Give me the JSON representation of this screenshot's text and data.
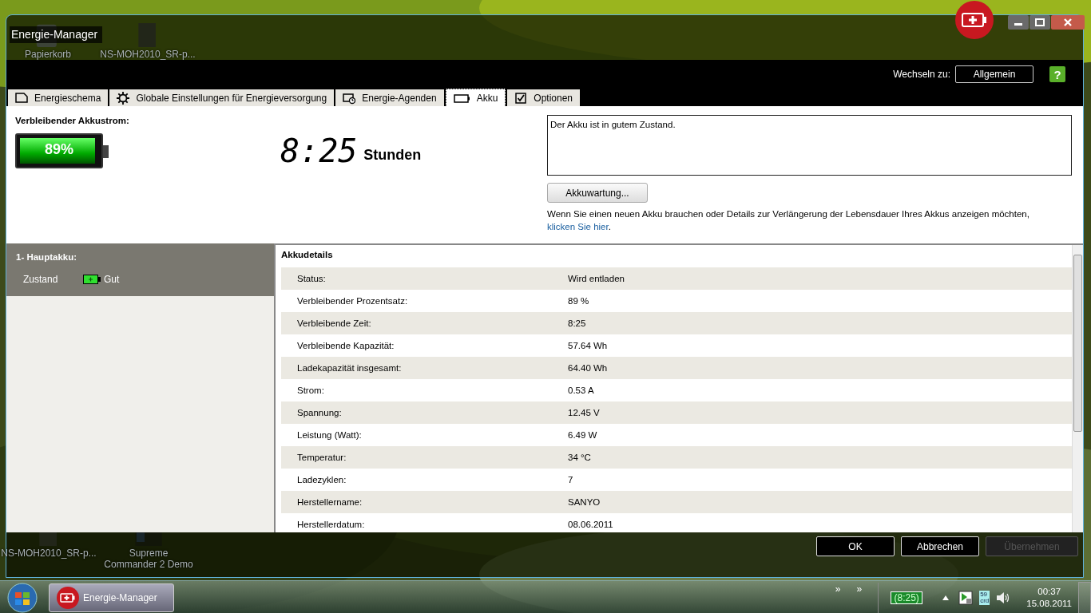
{
  "desktop": {
    "icons": [
      {
        "label": "Papierkorb",
        "kind": "bin"
      },
      {
        "label": "NS-MOH2010_SR-p...",
        "kind": "file"
      },
      {
        "label": "NS-MOH2010_SR-p...",
        "kind": "file"
      },
      {
        "label": "Supreme Commander 2 Demo",
        "kind": "game"
      }
    ]
  },
  "window": {
    "title": "Energie-Manager",
    "switch_label": "Wechseln zu:",
    "switch_button": "Allgemein",
    "help_glyph": "?",
    "tabs": [
      {
        "label": "Energieschema",
        "kind": "page",
        "selected": false
      },
      {
        "label": "Globale Einstellungen für Energieversorgung",
        "kind": "gear",
        "selected": false
      },
      {
        "label": "Energie-Agenden",
        "kind": "schedule",
        "selected": false
      },
      {
        "label": "Akku",
        "kind": "battery",
        "selected": true
      },
      {
        "label": "Optionen",
        "kind": "checkbox",
        "selected": false
      }
    ],
    "remaining": {
      "label": "Verbleibender Akkustrom:",
      "level": 0.89,
      "percent": "89%",
      "time": "8:25",
      "unit": "Stunden"
    },
    "status_message": "Der Akku ist in gutem Zustand.",
    "maintenance_button": "Akkuwartung...",
    "info_text": "Wenn Sie einen neuen Akku brauchen oder Details zur Verlängerung der Lebensdauer Ihres Akkus anzeigen möchten,",
    "info_link": "klicken Sie hier",
    "info_end": ".",
    "battery_list": {
      "title": "1- Hauptakku:",
      "state_label": "Zustand",
      "state_value": "Gut"
    },
    "details": {
      "title": "Akkudetails",
      "rows": [
        {
          "label": "Status:",
          "value": "Wird entladen"
        },
        {
          "label": "Verbleibender Prozentsatz:",
          "value": "89 %"
        },
        {
          "label": "Verbleibende Zeit:",
          "value": "8:25"
        },
        {
          "label": "Verbleibende Kapazität:",
          "value": "57.64 Wh"
        },
        {
          "label": "Ladekapazität insgesamt:",
          "value": "64.40 Wh"
        },
        {
          "label": "Strom:",
          "value": "0.53 A"
        },
        {
          "label": "Spannung:",
          "value": "12.45 V"
        },
        {
          "label": "Leistung (Watt):",
          "value": "6.49 W"
        },
        {
          "label": "Temperatur:",
          "value": "34 °C"
        },
        {
          "label": "Ladezyklen:",
          "value": "7"
        },
        {
          "label": "Herstellername:",
          "value": "SANYO"
        },
        {
          "label": "Herstellerdatum:",
          "value": "08.06.2011"
        }
      ]
    },
    "buttons": [
      {
        "label": "OK",
        "disabled": false
      },
      {
        "label": "Abbrechen",
        "disabled": false
      },
      {
        "label": "Übernehmen",
        "disabled": true
      }
    ]
  },
  "taskbar": {
    "app": "Energie-Manager",
    "chevrons": [
      "»",
      "»"
    ],
    "battery_time": "(8:25)",
    "tray_badge": [
      "59",
      "crd"
    ],
    "time": "00:37",
    "date": "15.08.2011"
  }
}
